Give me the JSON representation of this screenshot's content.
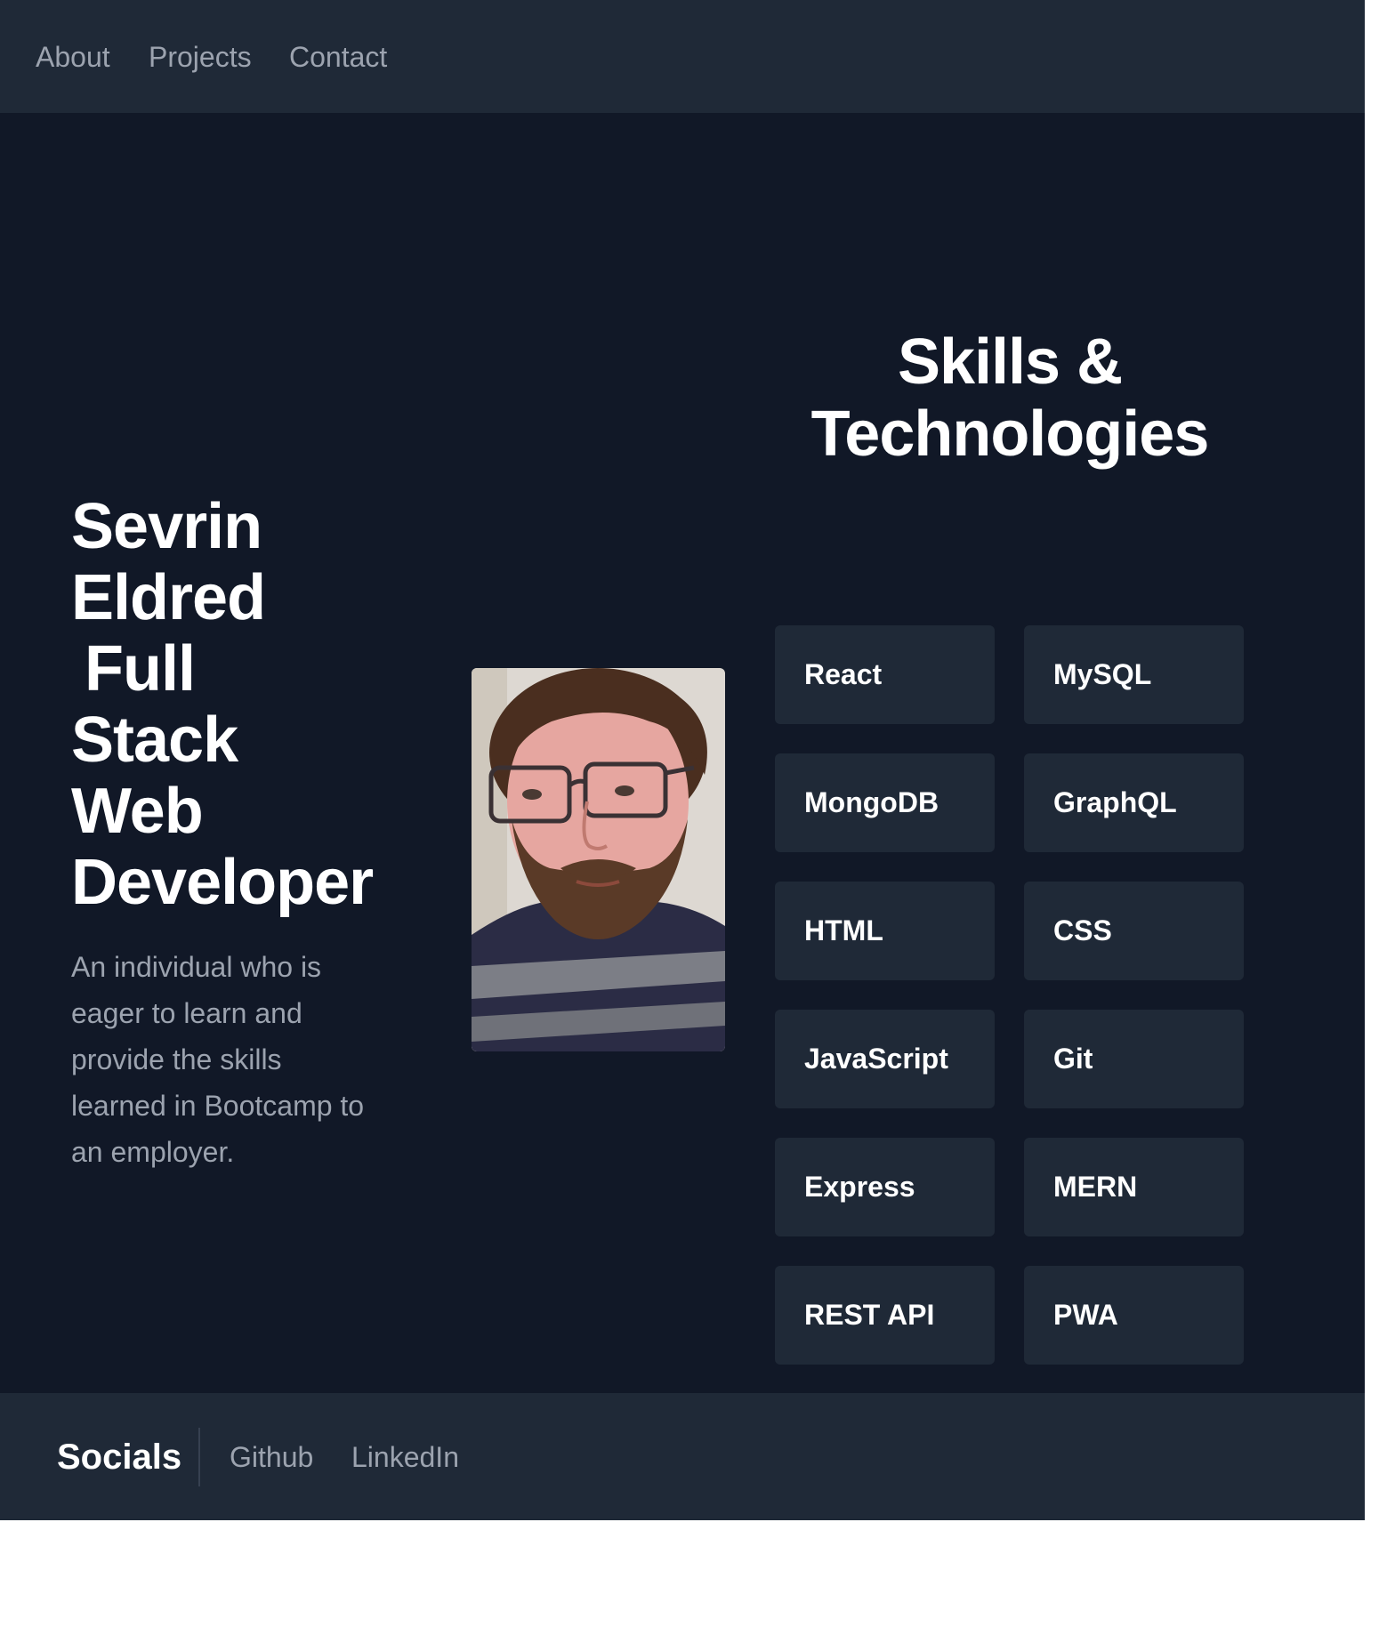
{
  "nav": {
    "items": [
      {
        "label": "About"
      },
      {
        "label": "Projects"
      },
      {
        "label": "Contact"
      }
    ]
  },
  "intro": {
    "heading_lines": [
      "Sevrin",
      "Eldred",
      "Full",
      "Stack",
      "Web",
      "Developer"
    ],
    "description": "An individual who is eager to learn and provide the skills learned in Bootcamp to an employer."
  },
  "avatar": {
    "icon": "profile-photo"
  },
  "skills": {
    "title_line1": "Skills &",
    "title_line2": "Technologies",
    "items": [
      {
        "label": "React"
      },
      {
        "label": "MySQL"
      },
      {
        "label": "MongoDB"
      },
      {
        "label": "GraphQL"
      },
      {
        "label": "HTML"
      },
      {
        "label": "CSS"
      },
      {
        "label": "JavaScript"
      },
      {
        "label": "Git"
      },
      {
        "label": "Express"
      },
      {
        "label": "MERN"
      },
      {
        "label": "REST API"
      },
      {
        "label": "PWA"
      }
    ]
  },
  "footer": {
    "title": "Socials",
    "links": [
      {
        "label": "Github"
      },
      {
        "label": "LinkedIn"
      }
    ]
  },
  "colors": {
    "page_bg": "#111827",
    "panel_bg": "#1f2937",
    "muted_text": "#9ca3af",
    "heading_text": "#ffffff"
  }
}
